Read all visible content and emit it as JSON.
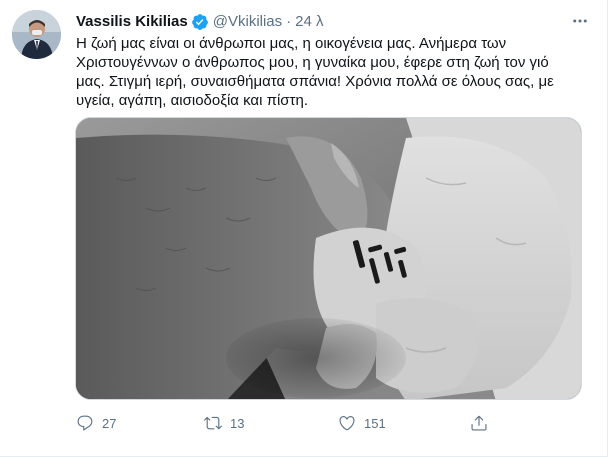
{
  "author": {
    "display_name": "Vassilis Kikilias",
    "handle": "@Vkikilias",
    "separator": "·",
    "time": "24 λ"
  },
  "tweet": {
    "text": "Η ζωή μας είναι οι άνθρωποι μας, η οικογένεια μας. Ανήμερα των Χριστουγέννων ο άνθρωπος μου, η γυναίκα μου, έφερε στη ζωή τον γιό μας. Στιγμή ιερή, συναισθήματα σπάνια! Χρόνια πολλά σε όλους σας, με υγεία, αγάπη, αισιοδοξία και πίστη."
  },
  "actions": {
    "reply_count": "27",
    "retweet_count": "13",
    "like_count": "151"
  },
  "icons": {
    "verified": "verified-badge-icon",
    "more": "more-dots-icon",
    "reply": "reply-bubble-icon",
    "retweet": "retweet-arrows-icon",
    "like": "heart-icon",
    "share": "share-upload-icon"
  },
  "colors": {
    "text_primary": "#0f1419",
    "text_secondary": "#5b7083",
    "verified_blue": "#1da1f2",
    "border": "#cfd9de"
  }
}
